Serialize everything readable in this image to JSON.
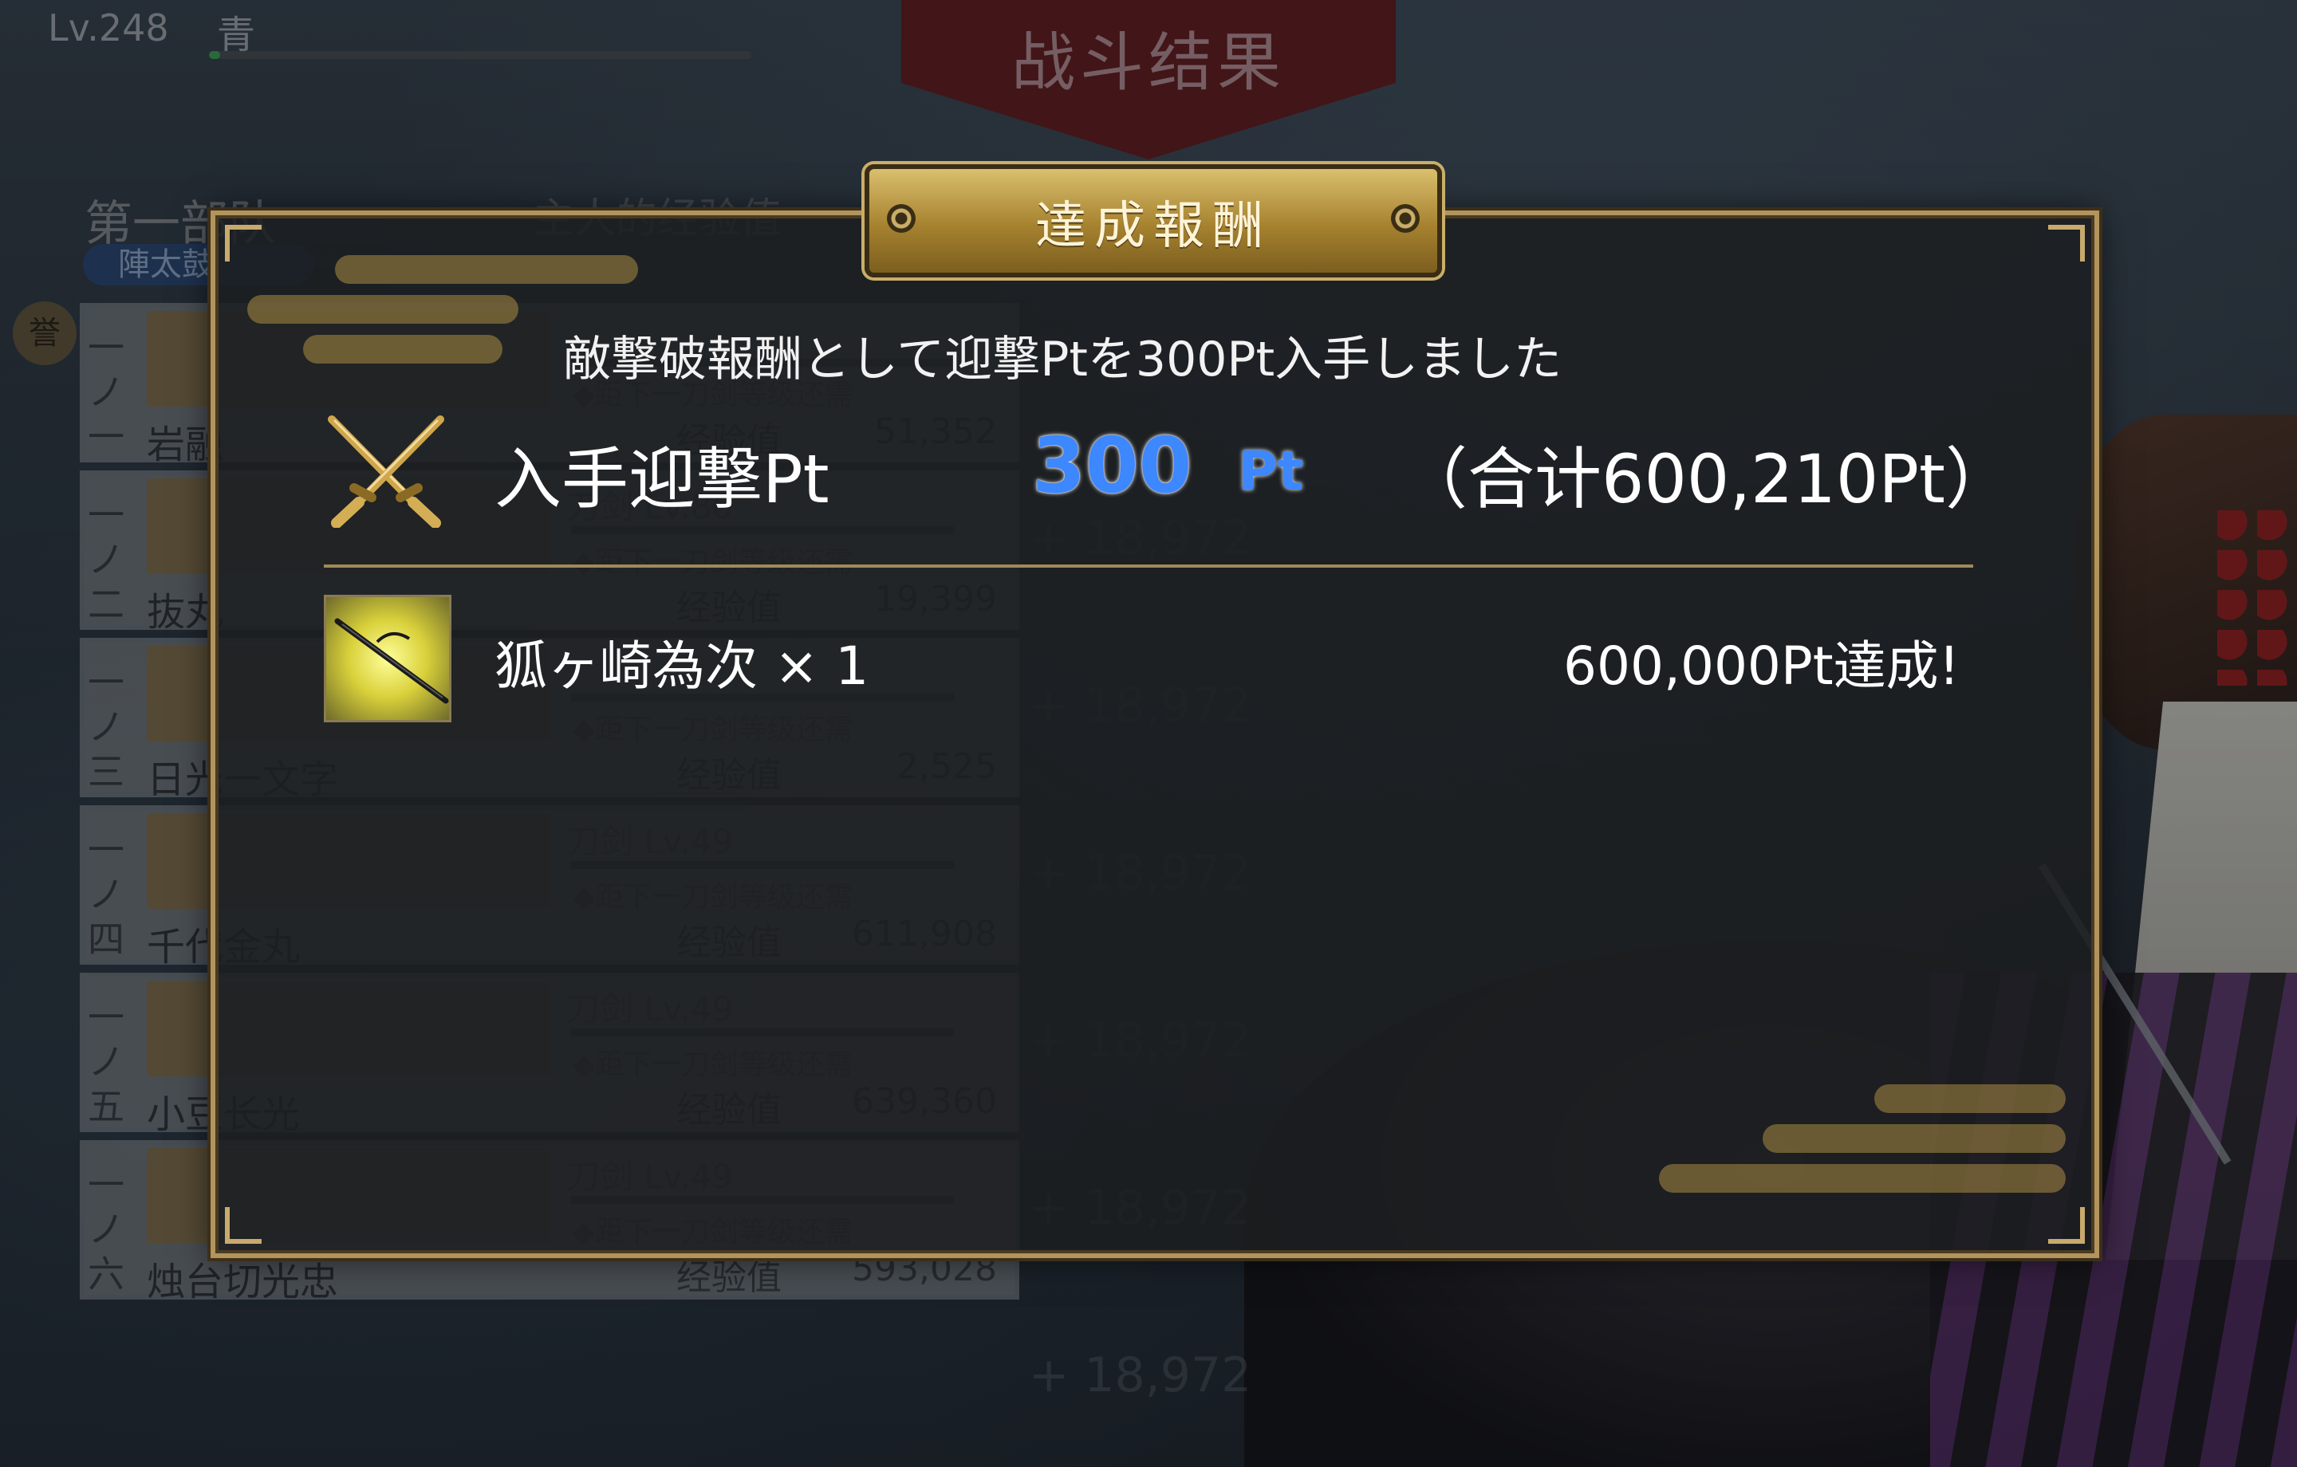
{
  "player": {
    "level": "Lv.248",
    "name": "青",
    "exp_fraction": 0.02
  },
  "battle": {
    "title": "战斗结果"
  },
  "team": {
    "label": "第一部队",
    "master_exp_label": "主人的经验值",
    "leader_badge": "陣太鼓",
    "rank_icon": "誉",
    "gain_value": "+ 18,972",
    "units": [
      {
        "position": "一ノ一",
        "name": "岩融",
        "level": "",
        "next": "◆距下一刀剑等级还需",
        "exp_label": "经验值",
        "exp_value": "51,352"
      },
      {
        "position": "一ノ二",
        "name": "抜丸",
        "level": "刀剑 Lv.80",
        "next": "◆距下一刀剑等级还需",
        "exp_label": "经验值",
        "exp_value": "19,399"
      },
      {
        "position": "一ノ三",
        "name": "日光一文字",
        "level": "",
        "next": "◆距下一刀剑等级还需",
        "exp_label": "经验值",
        "exp_value": "2,525"
      },
      {
        "position": "一ノ四",
        "name": "千代金丸",
        "level": "刀剑 Lv.49",
        "next": "◆距下一刀剑等级还需",
        "exp_label": "经验值",
        "exp_value": "611,908"
      },
      {
        "position": "一ノ五",
        "name": "小豆长光",
        "level": "刀剑 Lv.49",
        "next": "◆距下一刀剑等级还需",
        "exp_label": "经验值",
        "exp_value": "639,360"
      },
      {
        "position": "一ノ六",
        "name": "烛台切光忠",
        "level": "刀剑 Lv.49",
        "next": "◆距下一刀剑等级还需",
        "exp_label": "经验值",
        "exp_value": "593,028"
      }
    ]
  },
  "modal": {
    "title": "達成報酬",
    "message": "敵撃破報酬として迎撃Ptを300Pt入手しました",
    "points": {
      "icon": "crossed-swords-icon",
      "label": "入手迎撃Pt",
      "value": "300",
      "unit": "Pt",
      "total": "（合计600,210Pt）"
    },
    "rewards": [
      {
        "icon": "sword-item-icon",
        "name": "狐ヶ崎為次 × 1",
        "condition": "600,000Pt達成!"
      }
    ]
  },
  "colors": {
    "frame_gold": "#b2945c",
    "points_blue": "#3d87ff",
    "banner_red": "#6b1c1f"
  }
}
